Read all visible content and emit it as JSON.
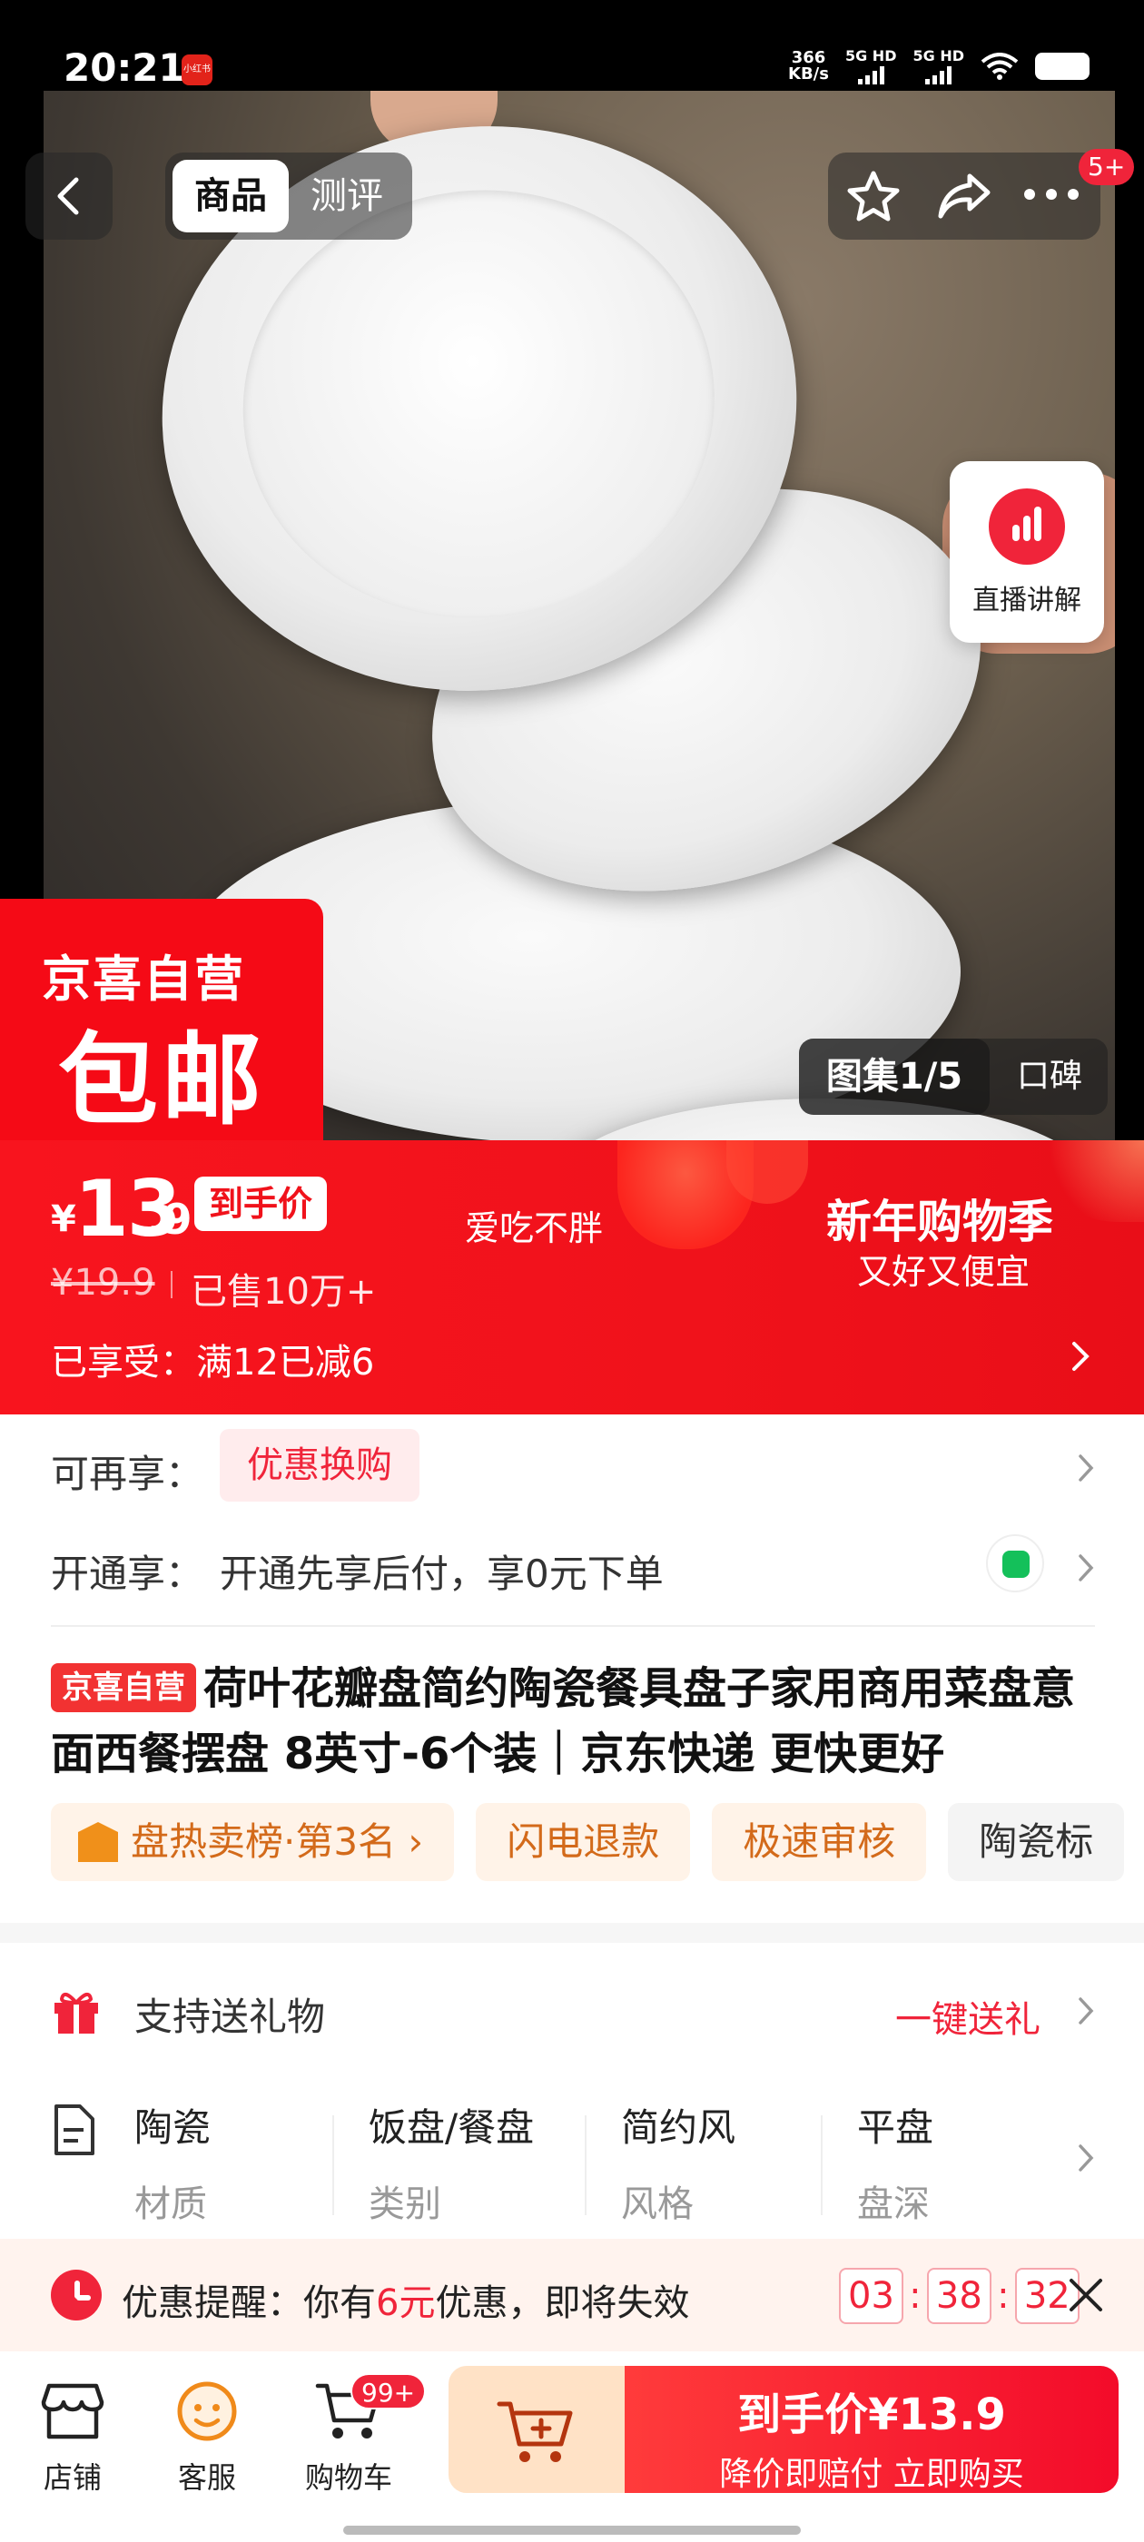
{
  "status_bar": {
    "time": "20:21",
    "app_badge": "小红书",
    "speed_value": "366",
    "speed_unit": "KB/s",
    "net1": "5G HD",
    "net2": "5G HD"
  },
  "hero": {
    "tabs": [
      {
        "label": "商品",
        "active": true
      },
      {
        "label": "测评",
        "active": false
      }
    ],
    "more_badge": "5+",
    "live_label": "直播讲解",
    "flag_line1": "京喜自营",
    "flag_line2": "包邮",
    "gallery_label": "图集1/5",
    "reviews_label": "口碑"
  },
  "price": {
    "currency": "¥",
    "integer": "13",
    "decimal": ".9",
    "tag": "到手价",
    "slogan": "爱吃不胖",
    "sale_title": "新年购物季",
    "sale_sub": "又好又便宜",
    "original": "¥19.9",
    "sold": "已售10万+",
    "enjoyed": "已享受：满12已减6"
  },
  "promos": {
    "more_label": "可再享：",
    "more_chip": "优惠换购",
    "open_label": "开通享：",
    "open_text": "开通先享后付，享0元下单"
  },
  "product": {
    "badge": "京喜自营",
    "title": "荷叶花瓣盘简约陶瓷餐具盘子家用商用菜盘意面西餐摆盘 8英寸-6个装｜京东快递 更快更好",
    "chips": [
      "盘热卖榜·第3名",
      "闪电退款",
      "极速审核",
      "陶瓷标"
    ]
  },
  "gift": {
    "label": "支持送礼物",
    "action": "一键送礼"
  },
  "attributes": [
    {
      "value": "陶瓷",
      "key": "材质"
    },
    {
      "value": "饭盘/餐盘",
      "key": "类别"
    },
    {
      "value": "简约风",
      "key": "风格"
    },
    {
      "value": "平盘",
      "key": "盘深"
    }
  ],
  "reminder": {
    "prefix": "优惠提醒：你有",
    "amount": "6元",
    "suffix": "优惠，即将失效",
    "hours": "03",
    "minutes": "38",
    "seconds": "32"
  },
  "bottom_bar": {
    "store": "店铺",
    "service": "客服",
    "cart": "购物车",
    "cart_badge": "99+",
    "buy_line1": "到手价¥13.9",
    "buy_line2": "降价即赔付 立即购买"
  },
  "colors": {
    "brand_red": "#f0121b",
    "accent_orange": "#d36a1a"
  }
}
